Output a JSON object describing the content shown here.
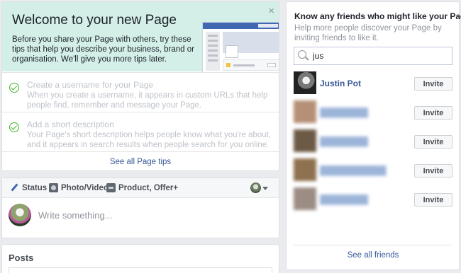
{
  "welcome": {
    "title": "Welcome to your new Page",
    "text": "Before you share your Page with others, try these tips that help you describe your business, brand or organisation. We'll give you more tips later.",
    "close": "×",
    "tips": [
      {
        "title": "Create a username for your Page",
        "text": "When you create a username, it appears in custom URLs that help people find, remember and message your Page."
      },
      {
        "title": "Add a short description",
        "text": "Your Page's short description helps people know what you're about, and it appears in search results when people search for you online."
      }
    ],
    "see_all": "See all Page tips"
  },
  "composer": {
    "tabs": [
      {
        "label": "Status",
        "icon": "pencil-icon"
      },
      {
        "label": "Photo/Video",
        "icon": "camera-icon"
      },
      {
        "label": "Product, Offer+",
        "icon": "product-icon"
      }
    ],
    "placeholder": "Write something..."
  },
  "posts": {
    "title": "Posts"
  },
  "invite": {
    "title": "Know any friends who might like your Page?",
    "subtitle": "Help more people discover your Page by inviting friends to like it.",
    "search_value": "jus",
    "friends": [
      {
        "name": "Justin Pot",
        "button": "Invite"
      },
      {
        "name": "",
        "button": "Invite"
      },
      {
        "name": "",
        "button": "Invite"
      },
      {
        "name": "",
        "button": "Invite"
      },
      {
        "name": "",
        "button": "Invite"
      }
    ],
    "see_all": "See all friends"
  },
  "colors": {
    "accent": "#4267b2",
    "link": "#365899",
    "check": "#42b72a",
    "welcome_bg": "#d3efe8"
  }
}
